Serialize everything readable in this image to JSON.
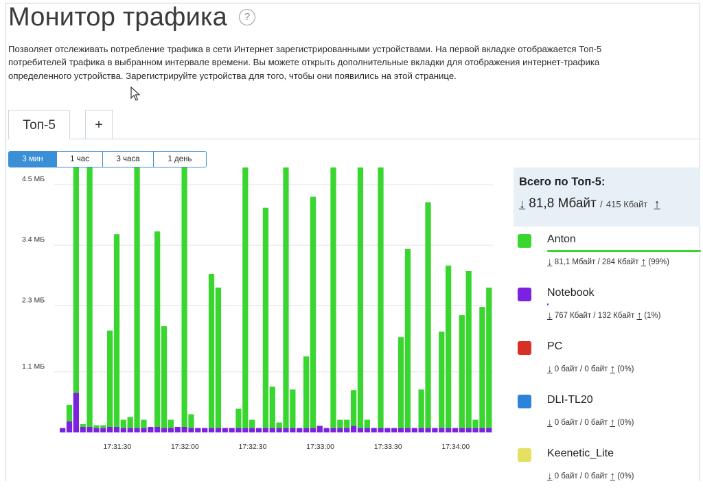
{
  "page": {
    "title": "Монитор трафика",
    "help_icon": "question-circle-icon",
    "description": "Позволяет отслеживать потребление трафика в сети Интернет зарегистрированными устройствами. На первой вкладке отображается Топ-5 потребителей трафика в выбранном интервале времени. Вы можете открыть дополнительные вкладки для отображения интернет-трафика определенного устройства. Зарегистрируйте устройства для того, чтобы они появились на этой странице."
  },
  "tabs": [
    {
      "label": "Топ-5",
      "active": true
    },
    {
      "label": "+",
      "active": false
    }
  ],
  "ranges": [
    {
      "label": "3 мин",
      "active": true
    },
    {
      "label": "1 час",
      "active": false
    },
    {
      "label": "3 часа",
      "active": false
    },
    {
      "label": "1 день",
      "active": false
    }
  ],
  "totals": {
    "title": "Всего по Топ-5:",
    "down": "81,8 Мбайт",
    "separator": "/",
    "up": "415 Кбайт",
    "down_icon": "download-arrow-icon",
    "up_icon": "upload-arrow-icon"
  },
  "devices": [
    {
      "name": "Anton",
      "color": "#39d62f",
      "share": 0.99,
      "down": "81,1 Мбайт",
      "up": "284 Кбайт",
      "percent": "(99%)"
    },
    {
      "name": "Notebook",
      "color": "#7a22e0",
      "share": 0.01,
      "down": "767 Кбайт",
      "up": "132 Кбайт",
      "percent": "(1%)"
    },
    {
      "name": "PC",
      "color": "#d93025",
      "share": 0,
      "down": "0 байт",
      "up": "0 байт",
      "percent": "(0%)"
    },
    {
      "name": "DLI-TL20",
      "color": "#2b84d8",
      "share": 0,
      "down": "0 байт",
      "up": "0 байт",
      "percent": "(0%)"
    },
    {
      "name": "Keenetic_Lite",
      "color": "#e6e062",
      "share": 0,
      "down": "0 байт",
      "up": "0 байт",
      "percent": "(0%)"
    }
  ],
  "chart_data": {
    "type": "bar",
    "stacked": true,
    "grid": true,
    "ylim": [
      0,
      4.8
    ],
    "yticks": [
      {
        "value": 1.1,
        "label": "1.1 МБ"
      },
      {
        "value": 2.3,
        "label": "2.3 МБ"
      },
      {
        "value": 3.4,
        "label": "3.4 МБ"
      },
      {
        "value": 4.5,
        "label": "4.5 МБ"
      }
    ],
    "xticks": [
      {
        "index": 8,
        "label": "17:31:30"
      },
      {
        "index": 18,
        "label": "17:32:00"
      },
      {
        "index": 28,
        "label": "17:32:30"
      },
      {
        "index": 38,
        "label": "17:33:00"
      },
      {
        "index": 48,
        "label": "17:33:30"
      },
      {
        "index": 58,
        "label": "17:34:00"
      }
    ],
    "series": [
      {
        "name": "Anton",
        "color": "#39d62f",
        "values": [
          0.0,
          0.3,
          5.5,
          0.05,
          5.5,
          0.05,
          0.05,
          1.75,
          3.5,
          0.15,
          0.2,
          5.5,
          0.15,
          0.0,
          3.55,
          1.85,
          0.15,
          0.0,
          5.5,
          0.25,
          0.0,
          0.0,
          2.8,
          2.55,
          0.0,
          0.0,
          0.35,
          5.5,
          0.15,
          0.0,
          4.0,
          0.75,
          0.1,
          5.5,
          0.7,
          0.0,
          1.3,
          4.2,
          0.0,
          0.0,
          5.5,
          0.15,
          0.15,
          0.65,
          5.5,
          0.15,
          0.0,
          5.5,
          0.0,
          0.0,
          1.65,
          3.25,
          0.0,
          0.7,
          4.1,
          0.0,
          1.75,
          2.95,
          0.0,
          2.05,
          2.85,
          0.15,
          2.2,
          2.55
        ]
      },
      {
        "name": "Notebook",
        "color": "#7a22e0",
        "values": [
          0.08,
          0.2,
          0.72,
          0.1,
          0.1,
          0.08,
          0.08,
          0.1,
          0.1,
          0.08,
          0.08,
          0.08,
          0.08,
          0.1,
          0.1,
          0.08,
          0.08,
          0.1,
          0.1,
          0.08,
          0.08,
          0.08,
          0.08,
          0.08,
          0.08,
          0.08,
          0.08,
          0.08,
          0.08,
          0.08,
          0.08,
          0.08,
          0.08,
          0.08,
          0.08,
          0.08,
          0.08,
          0.08,
          0.12,
          0.08,
          0.08,
          0.08,
          0.08,
          0.12,
          0.08,
          0.08,
          0.08,
          0.08,
          0.08,
          0.08,
          0.08,
          0.08,
          0.08,
          0.08,
          0.08,
          0.08,
          0.08,
          0.08,
          0.08,
          0.08,
          0.08,
          0.08,
          0.08,
          0.08
        ]
      }
    ]
  }
}
